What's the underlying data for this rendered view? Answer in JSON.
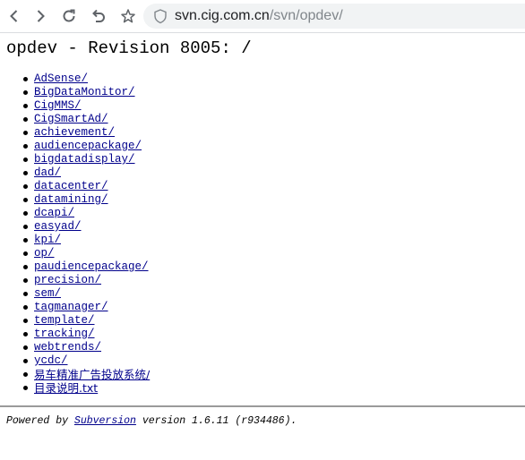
{
  "browser": {
    "url_host": "svn.cig.com.cn",
    "url_path": "/svn/opdev/",
    "icons": [
      "back-icon",
      "forward-icon",
      "reload-icon",
      "undo-icon",
      "star-icon",
      "shield-icon"
    ]
  },
  "page": {
    "title": "opdev - Revision 8005: /",
    "entries": [
      "AdSense/",
      "BigDataMonitor/",
      "CigMMS/",
      "CigSmartAd/",
      "achievement/",
      "audiencepackage/",
      "bigdatadisplay/",
      "dad/",
      "datacenter/",
      "datamining/",
      "dcapi/",
      "easyad/",
      "kpi/",
      "op/",
      "paudiencepackage/",
      "precision/",
      "sem/",
      "tagmanager/",
      "template/",
      "tracking/",
      "webtrends/",
      "ycdc/",
      "易车精准广告投放系统/",
      "目录说明.txt"
    ],
    "footer": {
      "prefix": "Powered by ",
      "link": "Subversion",
      "suffix": " version 1.6.11 (r934486)."
    }
  },
  "colors": {
    "link": "#00008b",
    "address_bg": "#f1f3f4",
    "url_host": "#202124",
    "url_path": "#80868b"
  }
}
